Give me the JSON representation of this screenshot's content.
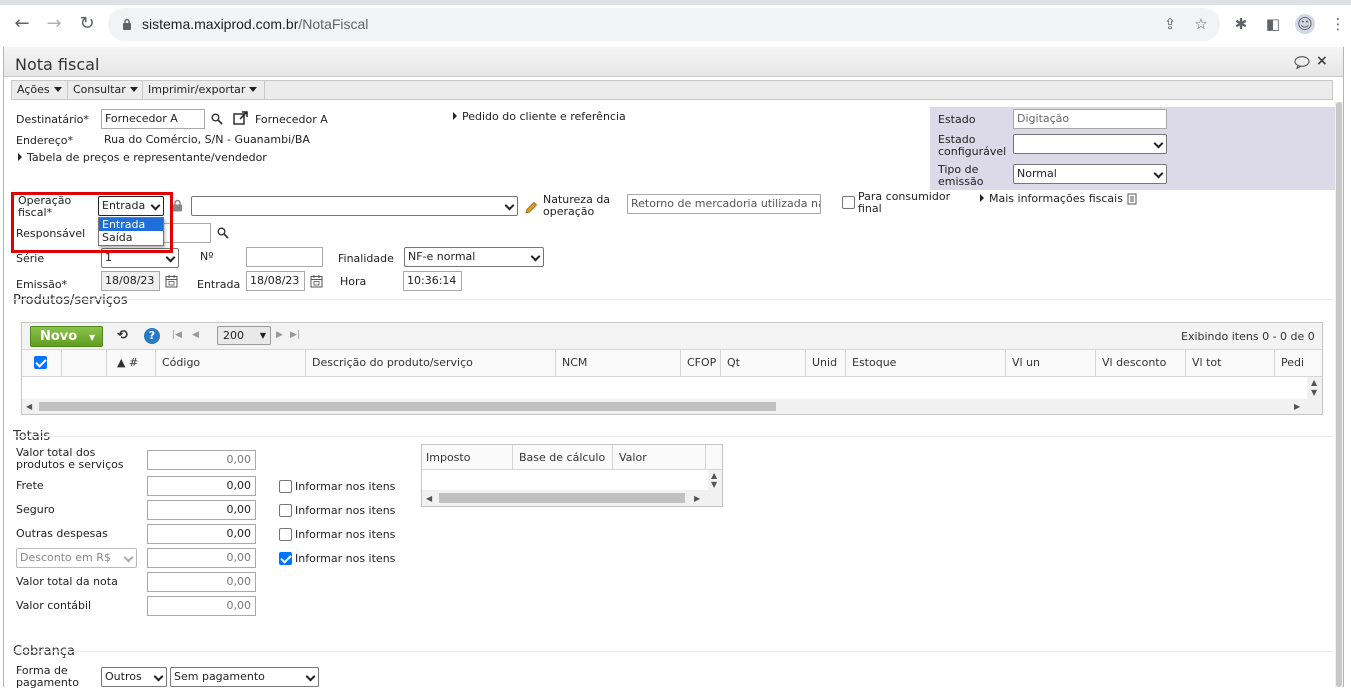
{
  "browser": {
    "url_host": "sistema.maxiprod.com.br",
    "url_path": "/NotaFiscal"
  },
  "window": {
    "title": "Nota fiscal"
  },
  "menu": [
    "Ações",
    "Consultar",
    "Imprimir/exportar"
  ],
  "header": {
    "destinatario_label": "Destinatário*",
    "destinatario_value": "Fornecedor A",
    "destinatario_link": "Fornecedor A",
    "endereco_label": "Endereço*",
    "endereco_value": "Rua do Comércio, S/N - Guanambi/BA",
    "tabela_precos": "Tabela de preços e representante/vendedor",
    "pedido_cliente": "Pedido do cliente e referência"
  },
  "state_panel": {
    "estado_label": "Estado",
    "estado_value": "Digitação",
    "estado_conf_label_1": "Estado",
    "estado_conf_label_2": "configurável",
    "estado_conf_value": "",
    "tipo_emissao_label_1": "Tipo de",
    "tipo_emissao_label_2": "emissão",
    "tipo_emissao_value": "Normal"
  },
  "operacao": {
    "label_1": "Operação",
    "label_2": "fiscal*",
    "value": "Entrada",
    "options": [
      "Entrada",
      "Saída"
    ],
    "natureza_label_1": "Natureza da",
    "natureza_label_2": "operação",
    "natureza_value": "Retorno de mercadoria utilizada na",
    "consumidor_label_1": "Para consumidor",
    "consumidor_label_2": "final",
    "mais_info": "Mais informações fiscais"
  },
  "responsavel_label": "Responsável",
  "serie": {
    "label": "Série",
    "value": "1",
    "numero_label": "Nº",
    "numero_value": "",
    "finalidade_label": "Finalidade",
    "finalidade_value": "NF-e normal"
  },
  "emissao": {
    "label": "Emissão*",
    "value": "18/08/23",
    "entrada_label": "Entrada",
    "entrada_value": "18/08/23",
    "hora_label": "Hora",
    "hora_value": "10:36:14"
  },
  "produtos": {
    "title": "Produtos/serviços",
    "novo_label": "Novo",
    "page_size": "200",
    "exibindo": "Exibindo itens 0 - 0 de 0",
    "columns": [
      "▲ #",
      "Código",
      "Descrição do produto/serviço",
      "NCM",
      "CFOP",
      "Qt",
      "Unid",
      "Estoque",
      "Vl un",
      "Vl desconto",
      "Vl tot",
      "Pedi"
    ]
  },
  "totais": {
    "title": "Totais",
    "valor_total_produtos_1": "Valor total dos",
    "valor_total_produtos_2": "produtos e serviços",
    "valor_total_produtos": "0,00",
    "frete_label": "Frete",
    "frete": "0,00",
    "seguro_label": "Seguro",
    "seguro": "0,00",
    "outras_label": "Outras despesas",
    "outras": "0,00",
    "desconto_select": "Desconto em R$",
    "desconto": "0,00",
    "valor_total_nota_label": "Valor total da nota",
    "valor_total_nota": "0,00",
    "valor_contabil_label": "Valor contábil",
    "valor_contabil": "0,00",
    "informar_itens": "Informar nos itens",
    "informar_checked": [
      false,
      false,
      false,
      true
    ],
    "impostos_columns": [
      "Imposto",
      "Base de cálculo",
      "Valor"
    ]
  },
  "cobranca": {
    "title": "Cobrança",
    "forma_label_1": "Forma de",
    "forma_label_2": "pagamento",
    "forma_value": "Outros",
    "pagamento_value": "Sem pagamento"
  }
}
